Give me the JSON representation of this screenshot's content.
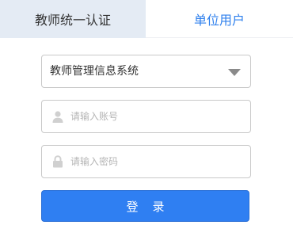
{
  "tabs": [
    {
      "label": "教师统一认证",
      "active": true
    },
    {
      "label": "单位用户",
      "active": false
    }
  ],
  "system_select": {
    "value": "教师管理信息系统",
    "icon": "chevron-down-icon"
  },
  "account": {
    "placeholder": "请输入账号",
    "value": "",
    "icon": "user-icon"
  },
  "password": {
    "placeholder": "请输入密码",
    "value": "",
    "icon": "lock-icon"
  },
  "login_button": {
    "label": "登录"
  },
  "colors": {
    "accent": "#2f7ff2",
    "tab_active_bg": "#e4ebf4",
    "tab_inactive_text": "#2f80ed",
    "placeholder": "#b5b5b5",
    "icon": "#d0d0d0"
  }
}
